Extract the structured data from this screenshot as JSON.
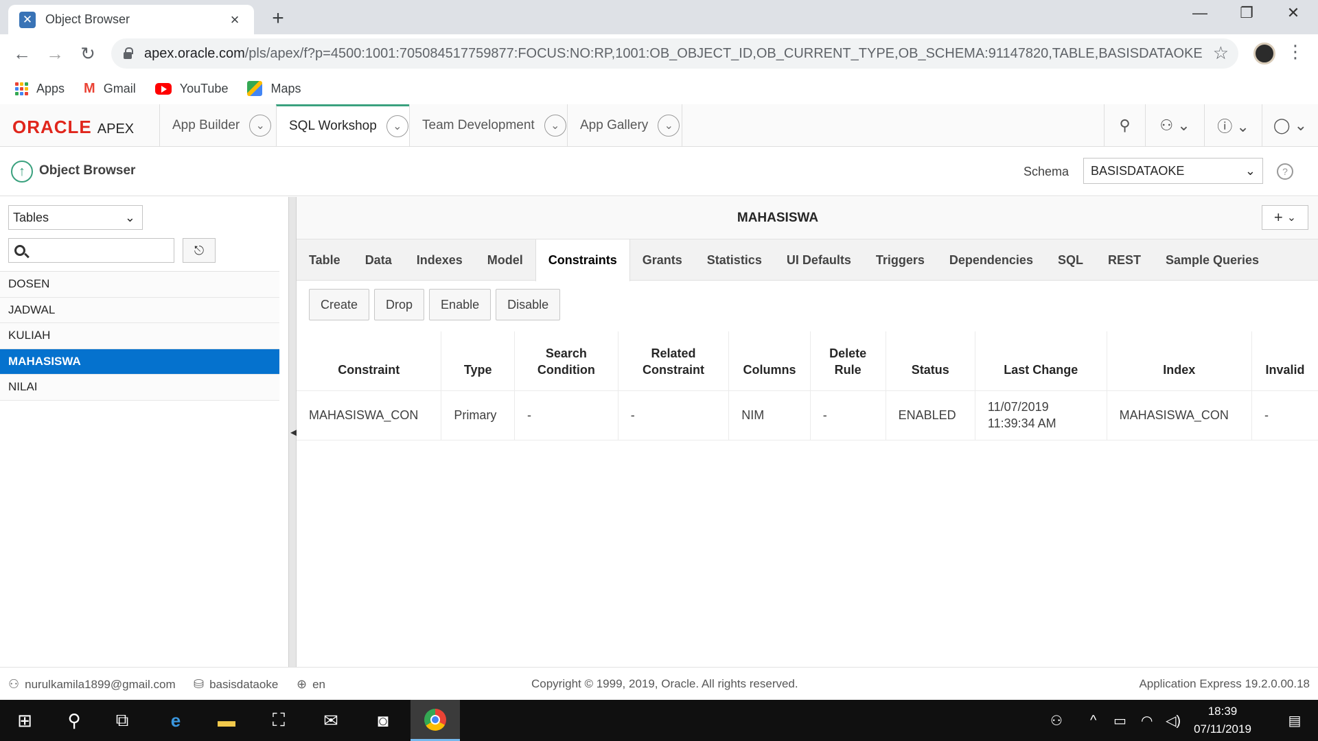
{
  "browser": {
    "tab_title": "Object Browser",
    "tab_icon": "apex-favicon",
    "url_host": "apex.oracle.com",
    "url_path": "/pls/apex/f?p=4500:1001:705084517759877:FOCUS:NO:RP,1001:OB_OBJECT_ID,OB_CURRENT_TYPE,OB_SCHEMA:91147820,TABLE,BASISDATAOKE",
    "bookmarks": [
      {
        "label": "Apps",
        "icon": "apps-grid-icon"
      },
      {
        "label": "Gmail",
        "icon": "gmail-icon"
      },
      {
        "label": "YouTube",
        "icon": "youtube-icon"
      },
      {
        "label": "Maps",
        "icon": "maps-icon"
      }
    ]
  },
  "apex": {
    "logo_oracle": "ORACLE",
    "logo_apex": "APEX",
    "nav": [
      {
        "label": "App Builder"
      },
      {
        "label": "SQL Workshop",
        "active": true
      },
      {
        "label": "Team Development"
      },
      {
        "label": "App Gallery"
      }
    ]
  },
  "page": {
    "title": "Object Browser",
    "schema_label": "Schema",
    "schema_value": "BASISDATAOKE"
  },
  "left": {
    "object_type": "Tables",
    "search_value": "",
    "objects": [
      "DOSEN",
      "JADWAL",
      "KULIAH",
      "MAHASISWA",
      "NILAI"
    ],
    "selected_index": 3
  },
  "main": {
    "object_name": "MAHASISWA",
    "tabs": [
      "Table",
      "Data",
      "Indexes",
      "Model",
      "Constraints",
      "Grants",
      "Statistics",
      "UI Defaults",
      "Triggers",
      "Dependencies",
      "SQL",
      "REST",
      "Sample Queries"
    ],
    "active_tab": "Constraints",
    "actions": [
      "Create",
      "Drop",
      "Enable",
      "Disable"
    ],
    "columns": [
      "Constraint",
      "Type",
      "Search\nCondition",
      "Related\nConstraint",
      "Columns",
      "Delete\nRule",
      "Status",
      "Last Change",
      "Index",
      "Invalid"
    ],
    "rows": [
      [
        "MAHASISWA_CON",
        "Primary",
        "-",
        "-",
        "NIM",
        "-",
        "ENABLED",
        "11/07/2019 11:39:34 AM",
        "MAHASISWA_CON",
        "-"
      ]
    ]
  },
  "footer": {
    "user": "nurulkamila1899@gmail.com",
    "workspace": "basisdataoke",
    "language": "en",
    "copyright": "Copyright © 1999, 2019, Oracle. All rights reserved.",
    "version": "Application Express 19.2.0.00.18"
  },
  "taskbar": {
    "time": "18:39",
    "date": "07/11/2019"
  },
  "colors": {
    "oracle_red": "#e0261c",
    "accent_green": "#3aa17e",
    "selected_blue": "#0572ce"
  }
}
